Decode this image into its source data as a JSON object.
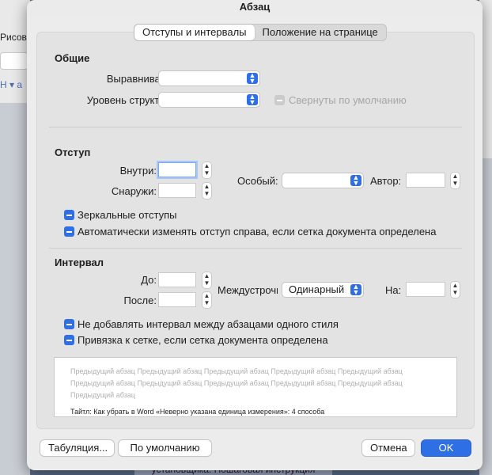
{
  "background": {
    "left_tab_text": "Рисова",
    "left_misc_text": "Н ▾ а",
    "bottom_text": "установщика. Пошаговая инструкция"
  },
  "dialog": {
    "title": "Абзац",
    "tabs": [
      {
        "label": "Отступы и интервалы",
        "active": true
      },
      {
        "label": "Положение на странице",
        "active": false
      }
    ],
    "general": {
      "heading": "Общие",
      "alignment_label": "Выравнивание:",
      "alignment_value": "",
      "outline_label": "Уровень структуры:",
      "outline_value": "",
      "collapsed_label": "Свернуты по умолчанию"
    },
    "indent": {
      "heading": "Отступ",
      "inside_label": "Внутри:",
      "inside_value": "",
      "outside_label": "Снаружи:",
      "outside_value": "",
      "special_label": "Особый:",
      "special_value": "",
      "by_label": "Автор:",
      "by_value": "",
      "mirror_label": "Зеркальные отступы",
      "auto_adjust_label": "Автоматически изменять отступ справа, если сетка документа определена"
    },
    "spacing": {
      "heading": "Интервал",
      "before_label": "До:",
      "before_value": "",
      "after_label": "После:",
      "after_value": "",
      "line_label": "Междустрочн",
      "line_value": "Одинарный",
      "at_label": "На:",
      "at_value": "",
      "no_space_label": "Не добавлять интервал между абзацами одного стиля",
      "snap_label": "Привязка к сетке, если сетка документа определена"
    },
    "preview": {
      "previous_text": "Предыдущий абзац Предыдущий абзац Предыдущий абзац Предыдущий абзац Предыдущий абзац Предыдущий абзац Предыдущий абзац Предыдущий абзац Предыдущий абзац Предыдущий абзац Предыдущий абзац",
      "current_text": "Тайтл: Как убрать в Word «Неверно указана единица измерения»: 4 способа"
    },
    "buttons": {
      "tabs": "Табуляция...",
      "default": "По умолчанию",
      "cancel": "Отмена",
      "ok": "OK"
    }
  },
  "colors": {
    "accent": "#2f6fe6"
  }
}
